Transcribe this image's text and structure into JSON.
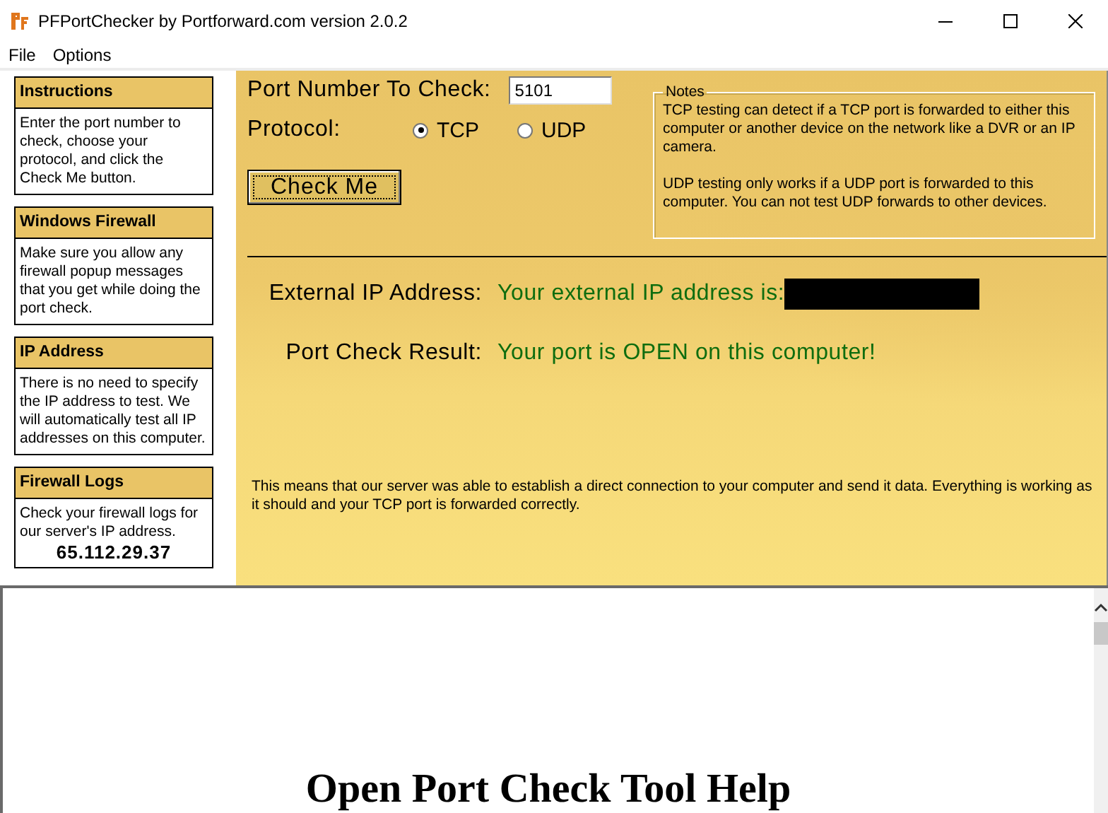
{
  "window": {
    "title": "PFPortChecker by Portforward.com version 2.0.2"
  },
  "menu": [
    {
      "label": "File"
    },
    {
      "label": "Options"
    }
  ],
  "info_cards": [
    {
      "heading": "Instructions",
      "body": "Enter the port number to check, choose your protocol, and click the Check Me button."
    },
    {
      "heading": "Windows Firewall",
      "body": "Make sure you allow any firewall popup messages that you get while doing the port check."
    },
    {
      "heading": "IP Address",
      "body": "There is no need to specify the IP address to test. We will automatically test all IP addresses on this computer."
    },
    {
      "heading": "Firewall Logs",
      "body": "Check your firewall logs for our server's IP address.",
      "address": "65.112.29.37"
    }
  ],
  "port_field": {
    "label": "Port Number To Check:",
    "value": "5101"
  },
  "protocol": {
    "label": "Protocol:",
    "options": [
      {
        "label": "TCP",
        "selected": true
      },
      {
        "label": "UDP",
        "selected": false
      }
    ]
  },
  "check_button": "Check Me",
  "notes": {
    "title": "Notes",
    "paragraphs": [
      "TCP testing can detect if a TCP port is forwarded to either this computer or another device on the network like a DVR or an IP camera.",
      "UDP testing only works if a UDP port is forwarded to this computer. You can not test UDP forwards to other devices."
    ]
  },
  "results": [
    {
      "label": "External IP Address:",
      "value": "Your external IP address is:",
      "redacted": true
    },
    {
      "label": "Port Check Result:",
      "value": "Your port is OPEN on this computer!",
      "redacted": false
    }
  ],
  "explanation": "This means that our server was able to establish a direct connection to your computer and send it data. Everything is working as it should and your TCP port is forwarded correctly.",
  "help": {
    "heading": "Open Port Check Tool Help"
  }
}
